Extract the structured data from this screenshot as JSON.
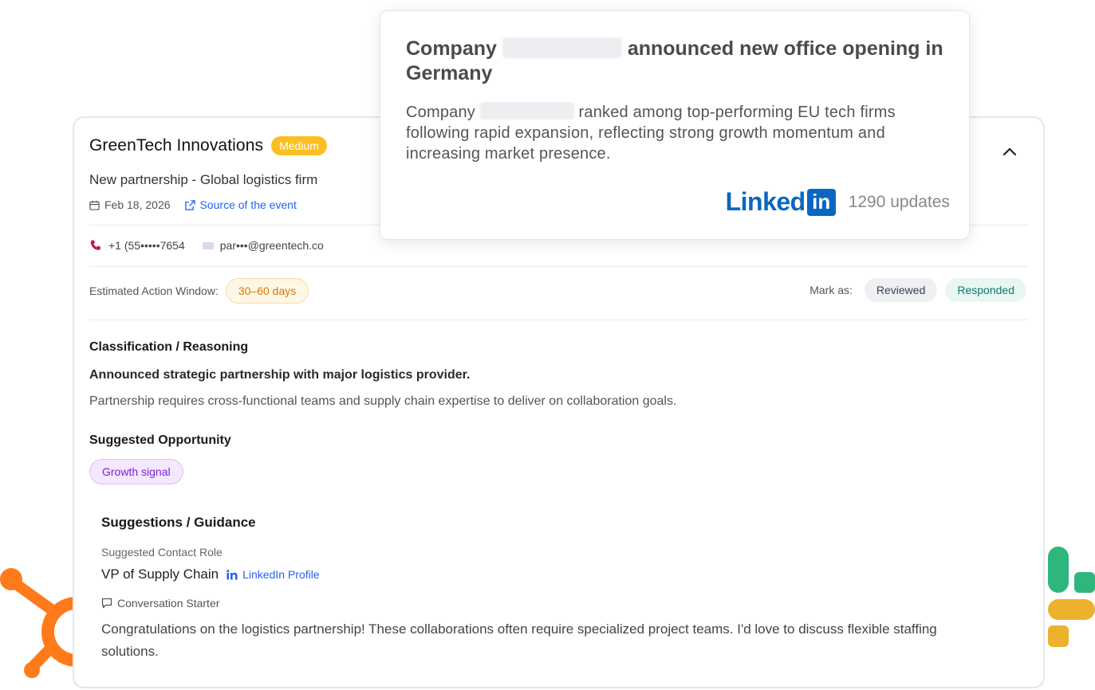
{
  "popup": {
    "title_before": "Company",
    "title_after": "announced new office opening in Germany",
    "body_before": "Company",
    "body_after": "ranked among top-performing EU tech firms following rapid expansion, reflecting strong growth momentum and increasing market presence.",
    "brand_word": "Linked",
    "brand_box": "in",
    "updates": "1290 updates"
  },
  "card": {
    "company_name": "GreenTech Innovations",
    "priority": "Medium",
    "event_title": "New partnership - Global logistics firm",
    "date": "Feb 18, 2026",
    "source_link": "Source of the event",
    "phone": "+1 (55•••••7654",
    "email": "par•••@greentech.co",
    "action_window_label": "Estimated Action Window:",
    "action_window_value": "30–60 days",
    "mark_as_label": "Mark as:",
    "reviewed_label": "Reviewed",
    "responded_label": "Responded",
    "classification_heading": "Classification / Reasoning",
    "reason_headline": "Announced strategic partnership with major logistics provider.",
    "reason_detail": "Partnership requires cross-functional teams and supply chain expertise to deliver on collaboration goals.",
    "opportunity_heading": "Suggested Opportunity",
    "opportunity_tag": "Growth signal",
    "guidance_heading": "Suggestions / Guidance",
    "contact_role_label": "Suggested Contact Role",
    "contact_role": "VP of Supply Chain",
    "linkedin_profile_label": "LinkedIn Profile",
    "starter_label": "Conversation Starter",
    "starter_text": "Congratulations on the logistics partnership! These collaborations often require specialized project teams. I'd love to discuss flexible staffing solutions."
  },
  "icons": [
    "calendar-icon",
    "external-link-icon",
    "phone-icon",
    "mail-icon",
    "chevron-up-icon",
    "linkedin-icon",
    "chat-bubble-icon",
    "hubspot-logo",
    "slack-logo"
  ],
  "colors": {
    "priority_medium": "#fbbf24",
    "link_blue": "#2563eb",
    "linkedin_blue": "#0a66c2",
    "days_orange": "#d97706",
    "responded_teal": "#0f766e",
    "growth_purple": "#7e22ce",
    "hubspot_orange": "#ff7a1a"
  }
}
